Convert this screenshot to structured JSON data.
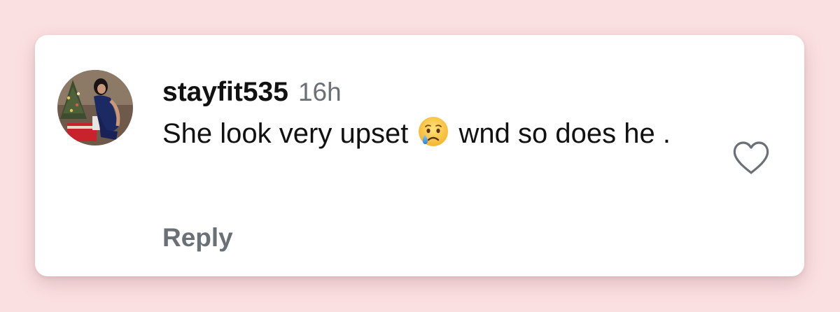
{
  "comment": {
    "username": "stayfit535",
    "timestamp": "16h",
    "text_before_emoji": "She look very upset ",
    "emoji": "crying-face-emoji",
    "text_after_emoji": " wnd so does he .",
    "reply_label": "Reply",
    "liked": false
  },
  "colors": {
    "background": "#fbe0e2",
    "card": "#ffffff",
    "username": "#111111",
    "secondary_text": "#6b6f76",
    "heart_outline": "#6b6f76"
  }
}
